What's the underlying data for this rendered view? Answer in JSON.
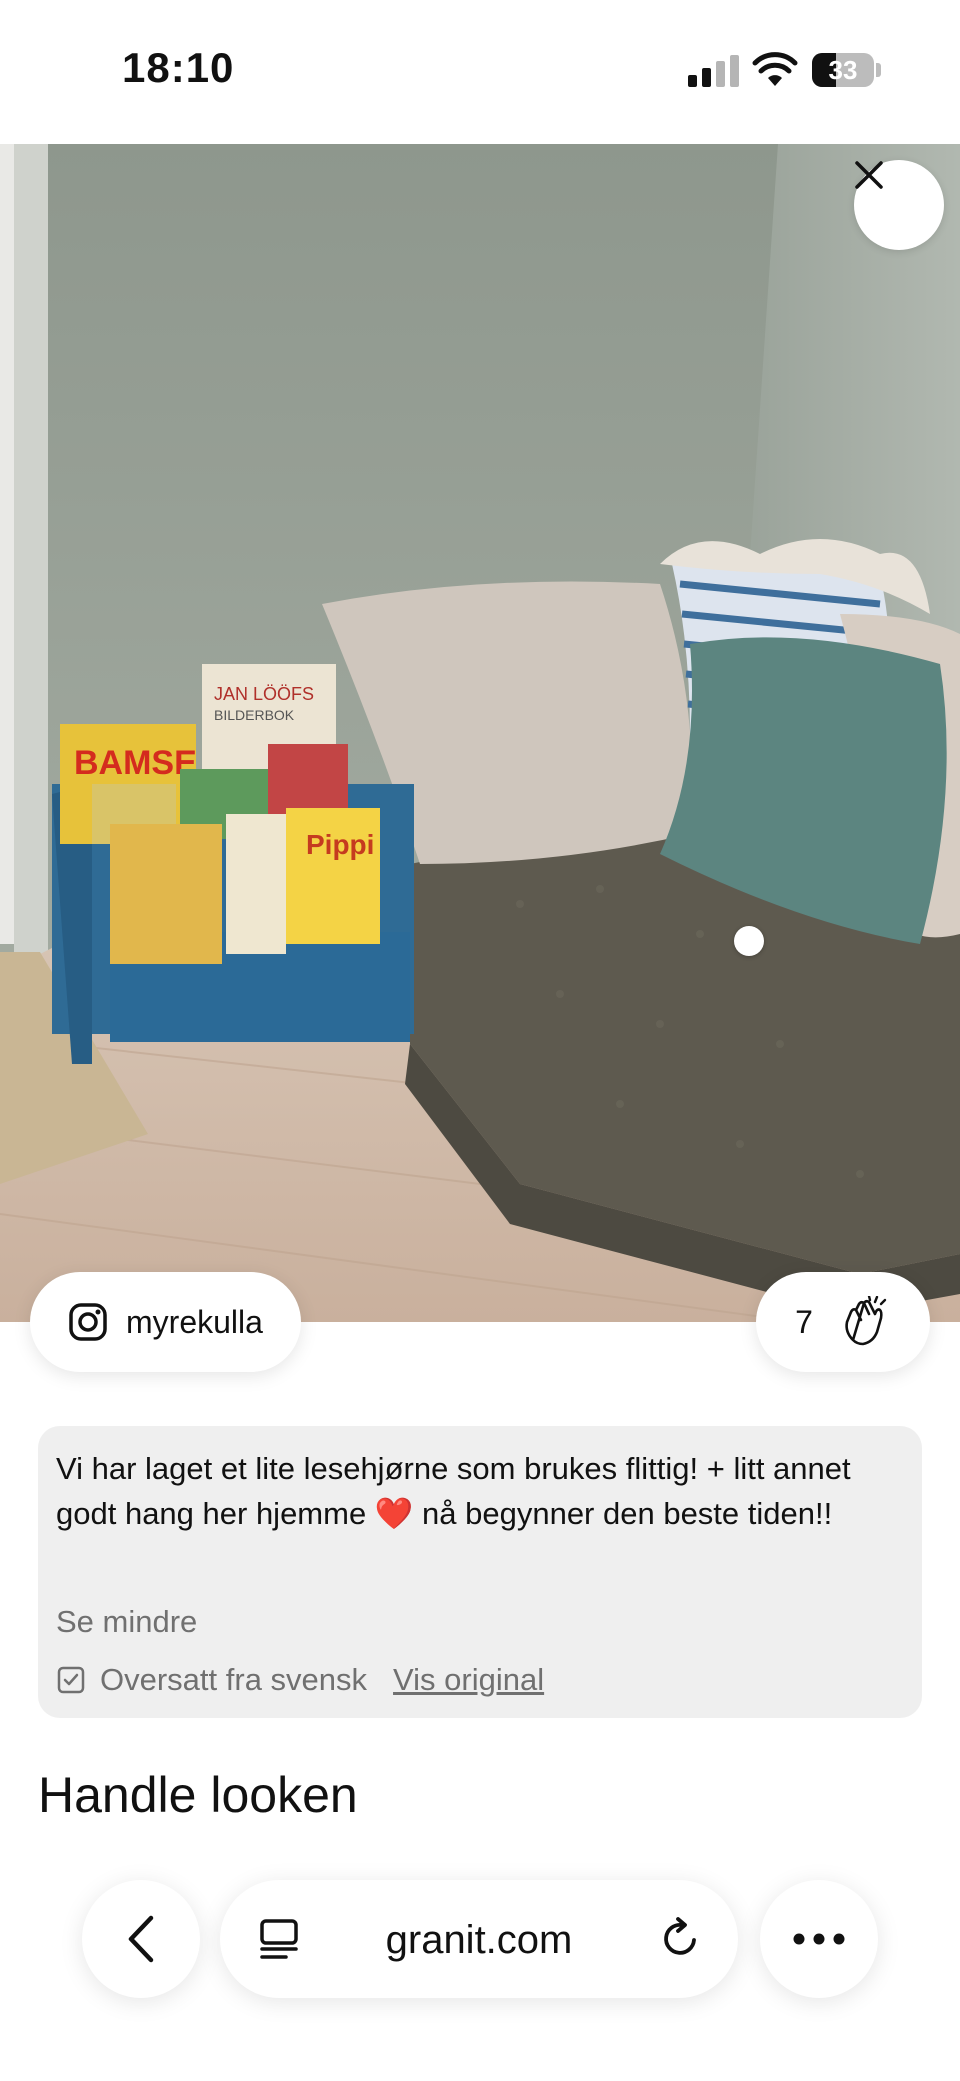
{
  "status_bar": {
    "time": "18:10",
    "battery": "33"
  },
  "icons": {
    "close": "close-icon",
    "instagram": "instagram-icon",
    "clap": "clap-icon",
    "translate": "checkbox-icon",
    "back": "chevron-left-icon",
    "reader": "reader-icon",
    "reload": "reload-icon",
    "more": "more-icon"
  },
  "post": {
    "author": "myrekulla",
    "claps": "7",
    "caption": "Vi har laget et lite lesehjørne som brukes flittig! + litt annet godt hang her hjemme ❤️ nå begynner den beste tiden!!",
    "see_less": "Se mindre",
    "translated_note": "Oversatt fra svensk",
    "show_original": "Vis original"
  },
  "section": {
    "title": "Handle looken"
  },
  "browser": {
    "url": "granit.com"
  }
}
